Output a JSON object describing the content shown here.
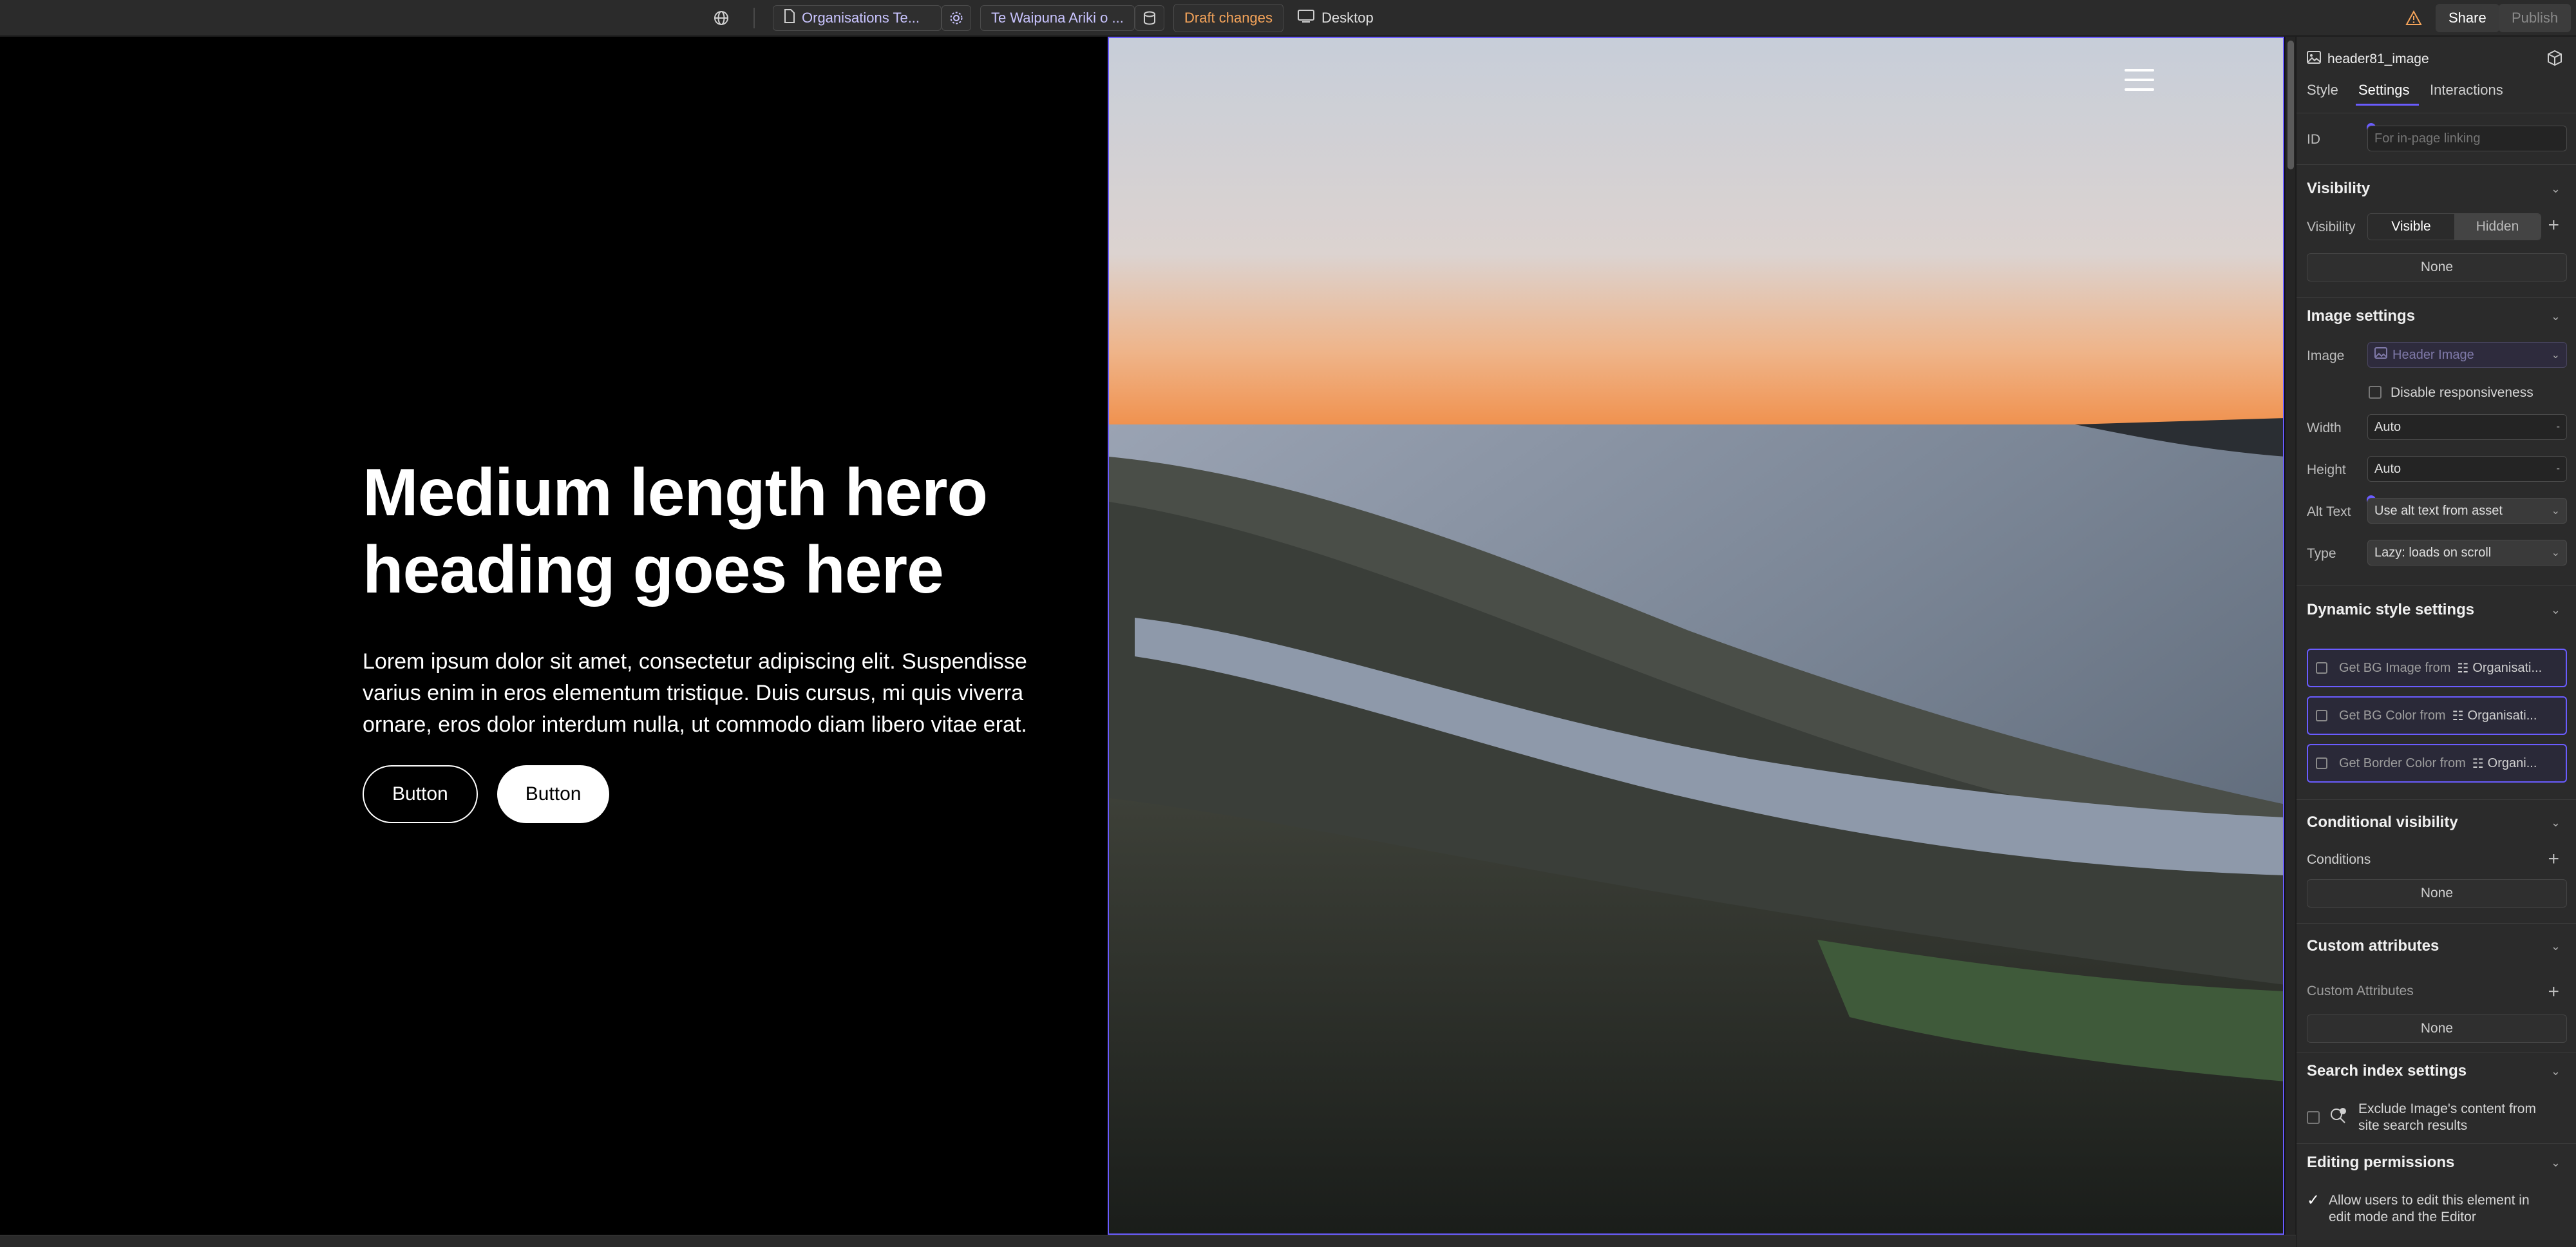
{
  "topbar": {
    "page_tab": "Organisations Te...",
    "collection_tab": "Te Waipuna Ariki o ...",
    "draft_label": "Draft changes",
    "device_label": "Desktop",
    "share_label": "Share",
    "publish_label": "Publish"
  },
  "hero": {
    "heading": "Medium length hero heading goes here",
    "body": "Lorem ipsum dolor sit amet, consectetur adipiscing elit. Suspendisse varius enim in eros elementum tristique. Duis cursus, mi quis viverra ornare, eros dolor interdum nulla, ut commodo diam libero vitae erat.",
    "button1": "Button",
    "button2": "Button"
  },
  "panel": {
    "element_name": "header81_image",
    "tabs": [
      "Style",
      "Settings",
      "Interactions"
    ],
    "active_tab": "Settings",
    "id_label": "ID",
    "id_placeholder": "For in-page linking",
    "visibility": {
      "title": "Visibility",
      "label": "Visibility",
      "options": [
        "Visible",
        "Hidden"
      ],
      "selected": "Visible",
      "none": "None"
    },
    "image_settings": {
      "title": "Image settings",
      "image_label": "Image",
      "image_value": "Header Image",
      "disable_responsiveness": "Disable responsiveness",
      "width_label": "Width",
      "width_value": "Auto",
      "height_label": "Height",
      "height_value": "Auto",
      "alt_label": "Alt Text",
      "alt_value": "Use alt text from asset",
      "type_label": "Type",
      "type_value": "Lazy: loads on scroll"
    },
    "dynamic": {
      "title": "Dynamic style settings",
      "rows": [
        {
          "label": "Get BG Image from",
          "source": "Organisati..."
        },
        {
          "label": "Get BG Color from",
          "source": "Organisati..."
        },
        {
          "label": "Get Border Color from",
          "source": "Organi..."
        }
      ]
    },
    "conditional": {
      "title": "Conditional visibility",
      "conditions_label": "Conditions",
      "none": "None"
    },
    "custom_attributes": {
      "title": "Custom attributes",
      "label": "Custom Attributes",
      "none": "None"
    },
    "search_index": {
      "title": "Search index settings",
      "exclude_line1": "Exclude Image's content from",
      "exclude_line2": "site search results"
    },
    "editing": {
      "title": "Editing permissions",
      "allow_line1": "Allow users to edit this element in",
      "allow_line2": "edit mode and the Editor"
    }
  },
  "colors": {
    "accent": "#6a5cff",
    "draft": "#f5a45a",
    "panel_bg": "#2b2b2b"
  }
}
